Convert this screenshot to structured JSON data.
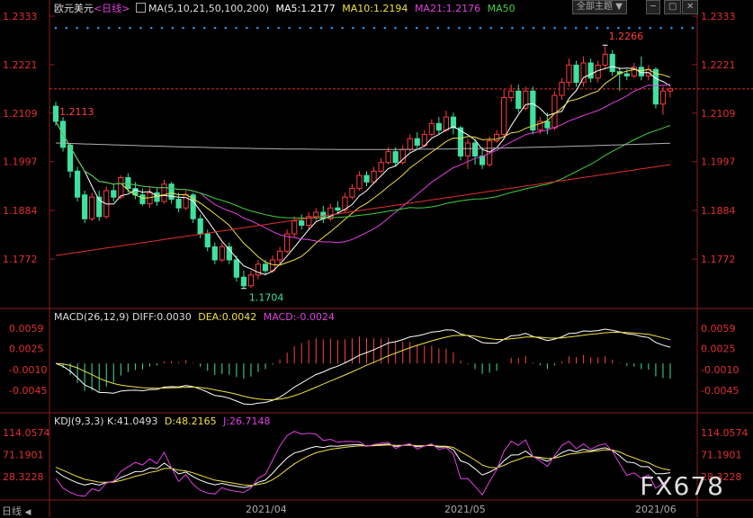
{
  "header": {
    "symbol": "欧元美元",
    "period": "<日线>",
    "ma_label": "MA(5,10,21,50,100,200)",
    "ma5": "MA5:1.2177",
    "ma10": "MA10:1.2194",
    "ma21": "MA21:1.2176",
    "ma50": "MA50",
    "theme_button": "全部主题",
    "colors": {
      "ma5": "#ffffff",
      "ma10": "#f0e040",
      "ma21": "#e040e0",
      "ma50": "#40d040",
      "ma100": "#b0b0b0",
      "ma200": "#e03030"
    }
  },
  "macd": {
    "label": "MACD(26,12,9)",
    "diff": "DIFF:0.0030",
    "dea": "DEA:0.0042",
    "macd": "MACD:-0.0024"
  },
  "kdj": {
    "label": "KDJ(9,3,3)",
    "k": "K:41.0493",
    "d": "D:48.2165",
    "j": "J:26.7148"
  },
  "footer": {
    "left_label": "日线",
    "tick_apr": "2021/04",
    "tick_may": "2021/05",
    "tick_jun": "2021/06"
  },
  "watermark": "FX678",
  "chart_data": {
    "type": "candlestick",
    "price_ticks": [
      "1.2333",
      "1.2221",
      "1.2109",
      "1.1997",
      "1.1884",
      "1.1772"
    ],
    "current_price": 1.2165,
    "annotations": [
      {
        "label": "1.2266",
        "value": 1.2266,
        "type": "high"
      },
      {
        "label": "1.2113",
        "value": 1.2113,
        "type": "level"
      },
      {
        "label": "1.1704",
        "value": 1.1704,
        "type": "low"
      }
    ],
    "candles": [
      [
        1.2125,
        1.209,
        1.2135,
        1.208
      ],
      [
        1.209,
        1.203,
        1.21,
        1.202
      ],
      [
        1.2035,
        1.1975,
        1.204,
        1.196
      ],
      [
        1.1975,
        1.1915,
        1.1985,
        1.1905
      ],
      [
        1.192,
        1.1865,
        1.193,
        1.1855
      ],
      [
        1.1865,
        1.1915,
        1.1925,
        1.186
      ],
      [
        1.1915,
        1.187,
        1.193,
        1.186
      ],
      [
        1.187,
        1.193,
        1.194,
        1.1865
      ],
      [
        1.193,
        1.1915,
        1.1945,
        1.1905
      ],
      [
        1.1915,
        1.196,
        1.1965,
        1.191
      ],
      [
        1.196,
        1.1935,
        1.197,
        1.1925
      ],
      [
        1.1935,
        1.192,
        1.195,
        1.191
      ],
      [
        1.192,
        1.19,
        1.1935,
        1.1895
      ],
      [
        1.19,
        1.1925,
        1.194,
        1.189
      ],
      [
        1.1925,
        1.1905,
        1.1935,
        1.1895
      ],
      [
        1.1905,
        1.1945,
        1.1955,
        1.19
      ],
      [
        1.1945,
        1.191,
        1.195,
        1.19
      ],
      [
        1.191,
        1.189,
        1.1925,
        1.188
      ],
      [
        1.189,
        1.192,
        1.193,
        1.1885
      ],
      [
        1.192,
        1.1865,
        1.1925,
        1.1855
      ],
      [
        1.1865,
        1.183,
        1.1875,
        1.182
      ],
      [
        1.183,
        1.18,
        1.184,
        1.179
      ],
      [
        1.18,
        1.177,
        1.181,
        1.176
      ],
      [
        1.177,
        1.18,
        1.181,
        1.1765
      ],
      [
        1.18,
        1.177,
        1.181,
        1.176
      ],
      [
        1.177,
        1.173,
        1.178,
        1.172
      ],
      [
        1.173,
        1.171,
        1.1745,
        1.1704
      ],
      [
        1.171,
        1.1735,
        1.1745,
        1.1705
      ],
      [
        1.1735,
        1.176,
        1.177,
        1.1725
      ],
      [
        1.176,
        1.1745,
        1.177,
        1.1735
      ],
      [
        1.1745,
        1.177,
        1.178,
        1.174
      ],
      [
        1.177,
        1.179,
        1.18,
        1.176
      ],
      [
        1.179,
        1.183,
        1.184,
        1.1785
      ],
      [
        1.183,
        1.186,
        1.187,
        1.182
      ],
      [
        1.186,
        1.185,
        1.1875,
        1.184
      ],
      [
        1.185,
        1.187,
        1.188,
        1.184
      ],
      [
        1.187,
        1.188,
        1.189,
        1.186
      ],
      [
        1.188,
        1.1865,
        1.1895,
        1.1855
      ],
      [
        1.1865,
        1.189,
        1.19,
        1.186
      ],
      [
        1.189,
        1.1885,
        1.1905,
        1.1875
      ],
      [
        1.1885,
        1.1915,
        1.1925,
        1.188
      ],
      [
        1.1915,
        1.1935,
        1.1945,
        1.191
      ],
      [
        1.1935,
        1.1965,
        1.1975,
        1.193
      ],
      [
        1.1965,
        1.195,
        1.1975,
        1.194
      ],
      [
        1.195,
        1.1975,
        1.1985,
        1.1945
      ],
      [
        1.1975,
        1.1995,
        1.2005,
        1.197
      ],
      [
        1.1995,
        1.202,
        1.203,
        1.199
      ],
      [
        1.202,
        1.1995,
        1.203,
        1.1985
      ],
      [
        1.1995,
        1.2025,
        1.2035,
        1.199
      ],
      [
        1.2025,
        1.205,
        1.206,
        1.202
      ],
      [
        1.205,
        1.2035,
        1.2065,
        1.2025
      ],
      [
        1.2035,
        1.206,
        1.207,
        1.203
      ],
      [
        1.206,
        1.2085,
        1.2095,
        1.2055
      ],
      [
        1.2085,
        1.207,
        1.21,
        1.206
      ],
      [
        1.207,
        1.21,
        1.2115,
        1.2065
      ],
      [
        1.21,
        1.2075,
        1.211,
        1.206
      ],
      [
        1.2075,
        1.201,
        1.208,
        1.2
      ],
      [
        1.201,
        1.204,
        1.205,
        1.198
      ],
      [
        1.204,
        1.201,
        1.205,
        1.199
      ],
      [
        1.201,
        1.199,
        1.203,
        1.198
      ],
      [
        1.199,
        1.2045,
        1.2055,
        1.1985
      ],
      [
        1.2045,
        1.206,
        1.207,
        1.204
      ],
      [
        1.206,
        1.2145,
        1.2165,
        1.2055
      ],
      [
        1.2145,
        1.216,
        1.2175,
        1.2135
      ],
      [
        1.216,
        1.212,
        1.2175,
        1.211
      ],
      [
        1.212,
        1.216,
        1.217,
        1.2115
      ],
      [
        1.216,
        1.207,
        1.217,
        1.206
      ],
      [
        1.207,
        1.209,
        1.21,
        1.206
      ],
      [
        1.209,
        1.2075,
        1.211,
        1.206
      ],
      [
        1.2075,
        1.215,
        1.216,
        1.207
      ],
      [
        1.215,
        1.218,
        1.219,
        1.214
      ],
      [
        1.218,
        1.222,
        1.2235,
        1.217
      ],
      [
        1.222,
        1.218,
        1.223,
        1.217
      ],
      [
        1.218,
        1.2225,
        1.224,
        1.217
      ],
      [
        1.2225,
        1.219,
        1.2235,
        1.218
      ],
      [
        1.219,
        1.222,
        1.223,
        1.218
      ],
      [
        1.222,
        1.2245,
        1.2266,
        1.221
      ],
      [
        1.2245,
        1.2205,
        1.2255,
        1.2195
      ],
      [
        1.2205,
        1.22,
        1.2215,
        1.216
      ],
      [
        1.22,
        1.2195,
        1.221,
        1.2185
      ],
      [
        1.2195,
        1.2215,
        1.2225,
        1.219
      ],
      [
        1.2215,
        1.2195,
        1.224,
        1.2185
      ],
      [
        1.2195,
        1.221,
        1.222,
        1.2185
      ],
      [
        1.221,
        1.213,
        1.2215,
        1.212
      ],
      [
        1.213,
        1.216,
        1.217,
        1.2105
      ],
      [
        1.216,
        1.2165,
        1.217,
        1.2145
      ]
    ],
    "kdj_ticks": [
      "114.0574",
      "71.1901",
      "28.3228"
    ],
    "macd_ticks": [
      "0.0059",
      "0.0025",
      "-0.0010",
      "-0.0045"
    ]
  }
}
